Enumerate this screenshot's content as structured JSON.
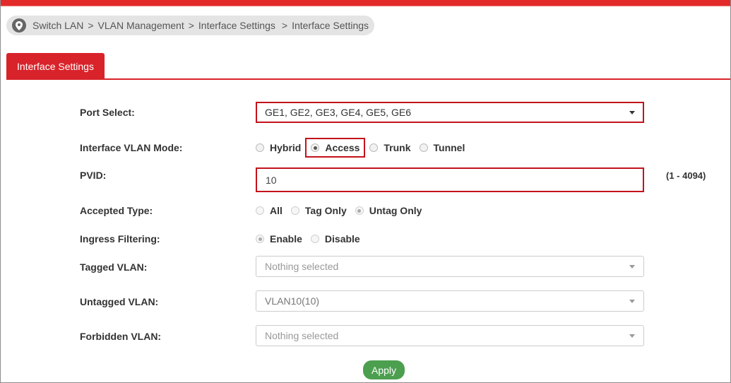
{
  "breadcrumb": {
    "items": [
      "Switch LAN",
      "VLAN Management",
      "Interface Settings",
      "Interface Settings"
    ],
    "separator": ">"
  },
  "tab": {
    "label": "Interface Settings"
  },
  "form": {
    "port_select": {
      "label": "Port Select:",
      "value": "GE1, GE2, GE3, GE4, GE5, GE6"
    },
    "vlan_mode": {
      "label": "Interface VLAN Mode:",
      "options": [
        "Hybrid",
        "Access",
        "Trunk",
        "Tunnel"
      ],
      "selected": "Access"
    },
    "pvid": {
      "label": "PVID:",
      "value": "10",
      "range": "(1 - 4094)"
    },
    "accepted_type": {
      "label": "Accepted Type:",
      "options": [
        "All",
        "Tag Only",
        "Untag Only"
      ],
      "selected": "Untag Only"
    },
    "ingress_filtering": {
      "label": "Ingress Filtering:",
      "options": [
        "Enable",
        "Disable"
      ],
      "selected": "Enable"
    },
    "tagged_vlan": {
      "label": "Tagged VLAN:",
      "value": "Nothing selected"
    },
    "untagged_vlan": {
      "label": "Untagged VLAN:",
      "value": "VLAN10(10)"
    },
    "forbidden_vlan": {
      "label": "Forbidden VLAN:",
      "value": "Nothing selected"
    }
  },
  "apply_button": {
    "label": "Apply"
  },
  "colors": {
    "accent": "#d9232a",
    "apply": "#4c9f4f",
    "highlight": "#c3131b"
  },
  "icons": {
    "breadcrumb": "location-pin-icon",
    "dropdown": "caret-down-icon"
  }
}
